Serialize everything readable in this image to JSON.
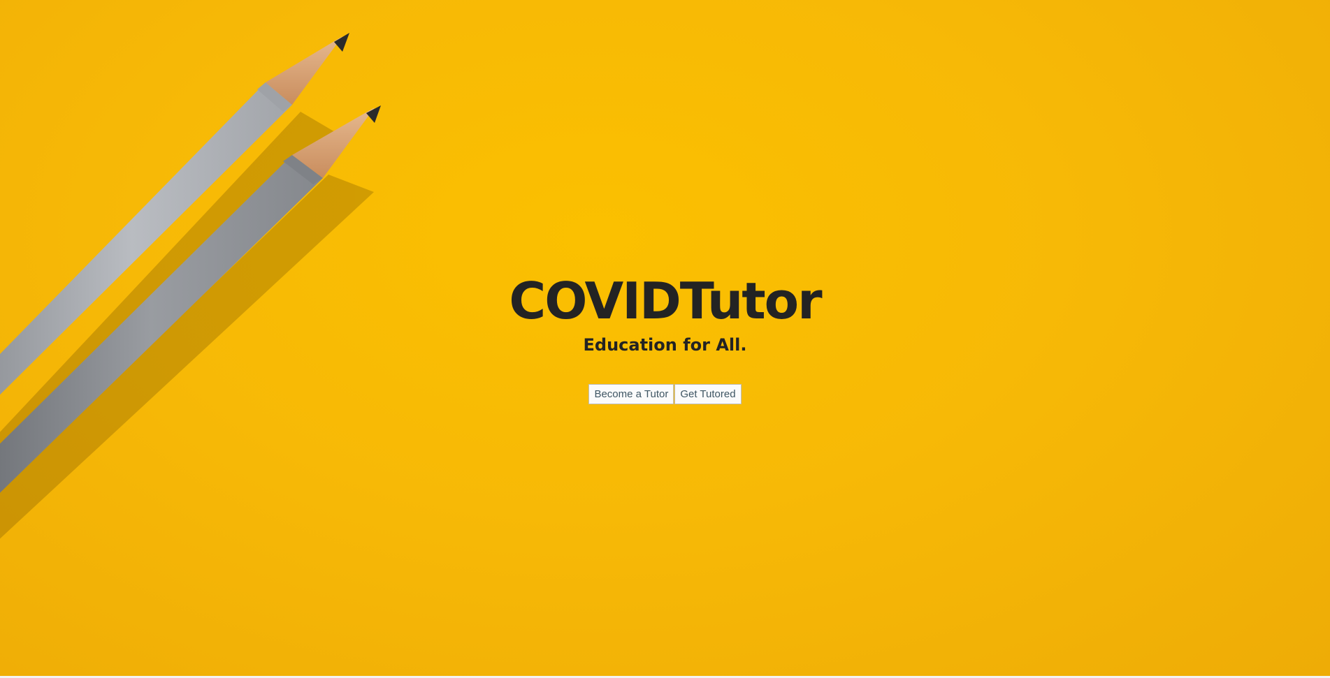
{
  "hero": {
    "title": "COVIDTutor",
    "tagline": "Education for All.",
    "background_color": "#f7b906",
    "background_image": "yellow-paper-with-two-pencils"
  },
  "actions": {
    "become_tutor_label": "Become a Tutor",
    "get_tutored_label": "Get Tutored"
  }
}
